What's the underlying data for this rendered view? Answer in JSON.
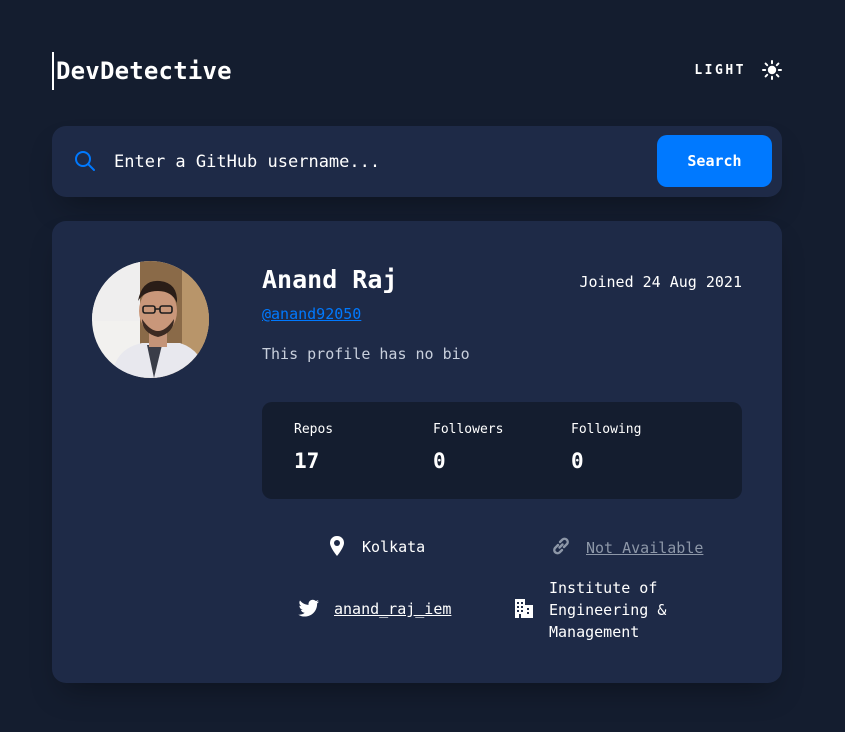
{
  "header": {
    "logo": "DevDetective",
    "mode_label": "LIGHT",
    "mode_icon": "sun-icon"
  },
  "search": {
    "placeholder": "Enter a GitHub username...",
    "button_label": "Search",
    "icon": "search-icon"
  },
  "profile": {
    "name": "Anand Raj",
    "joined": "Joined 24 Aug 2021",
    "username": "@anand92050",
    "bio": "This profile has no bio",
    "stats": [
      {
        "label": "Repos",
        "value": "17"
      },
      {
        "label": "Followers",
        "value": "0"
      },
      {
        "label": "Following",
        "value": "0"
      }
    ],
    "location": "Kolkata",
    "website": "Not Available",
    "twitter": "anand_raj_iem",
    "company": "Institute of Engineering & Management"
  },
  "colors": {
    "background": "#141d2f",
    "card": "#1e2a47",
    "accent": "#0079ff",
    "text": "#ffffff",
    "muted": "#8d97a8"
  }
}
